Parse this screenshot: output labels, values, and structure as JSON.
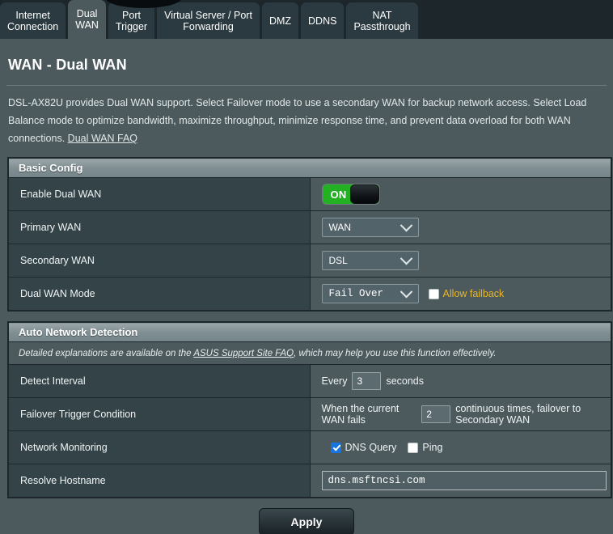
{
  "tabs": [
    {
      "label": "Internet\nConnection",
      "active": false
    },
    {
      "label": "Dual\nWAN",
      "active": true
    },
    {
      "label": "Port\nTrigger",
      "active": false
    },
    {
      "label": "Virtual Server / Port\nForwarding",
      "active": false
    },
    {
      "label": "DMZ",
      "active": false
    },
    {
      "label": "DDNS",
      "active": false
    },
    {
      "label": "NAT\nPassthrough",
      "active": false
    }
  ],
  "page": {
    "title": "WAN - Dual WAN",
    "description_part1": "DSL-AX82U provides Dual WAN support. Select Failover mode to use a secondary WAN for backup network access. Select Load Balance mode to optimize bandwidth, maximize throughput, minimize response time, and prevent data overload for both WAN connections. ",
    "description_link": "Dual WAN FAQ"
  },
  "basic_config": {
    "section_title": "Basic Config",
    "rows": {
      "enable_dual_wan": {
        "label": "Enable Dual WAN",
        "toggle_state": "ON"
      },
      "primary_wan": {
        "label": "Primary WAN",
        "value": "WAN"
      },
      "secondary_wan": {
        "label": "Secondary WAN",
        "value": "DSL"
      },
      "dual_wan_mode": {
        "label": "Dual WAN Mode",
        "value": "Fail Over",
        "allow_failback_label": "Allow failback",
        "allow_failback_checked": false
      }
    }
  },
  "auto_network_detection": {
    "section_title": "Auto Network Detection",
    "note_prefix": "Detailed explanations are available on the  ",
    "note_link": "ASUS Support Site FAQ",
    "note_suffix": ", which may help you use this function effectively.",
    "rows": {
      "detect_interval": {
        "label": "Detect Interval",
        "prefix": "Every",
        "value": "3",
        "suffix": "seconds"
      },
      "failover_trigger": {
        "label": "Failover Trigger Condition",
        "prefix": "When the current WAN fails",
        "value": "2",
        "suffix": "continuous times, failover to Secondary WAN"
      },
      "network_monitoring": {
        "label": "Network Monitoring",
        "dns_query_label": "DNS Query",
        "dns_query_checked": true,
        "ping_label": "Ping",
        "ping_checked": false
      },
      "resolve_hostname": {
        "label": "Resolve Hostname",
        "value": "dns.msftncsi.com"
      }
    }
  },
  "footer": {
    "apply_label": "Apply"
  },
  "colors": {
    "page_background": "#4c5a5e",
    "tabbar_background": "#1d272b",
    "label_column": "#334348",
    "toggle_on": "#23b023",
    "checkbox_checked": "#1675e0",
    "amber_text": "#e8b62b"
  }
}
